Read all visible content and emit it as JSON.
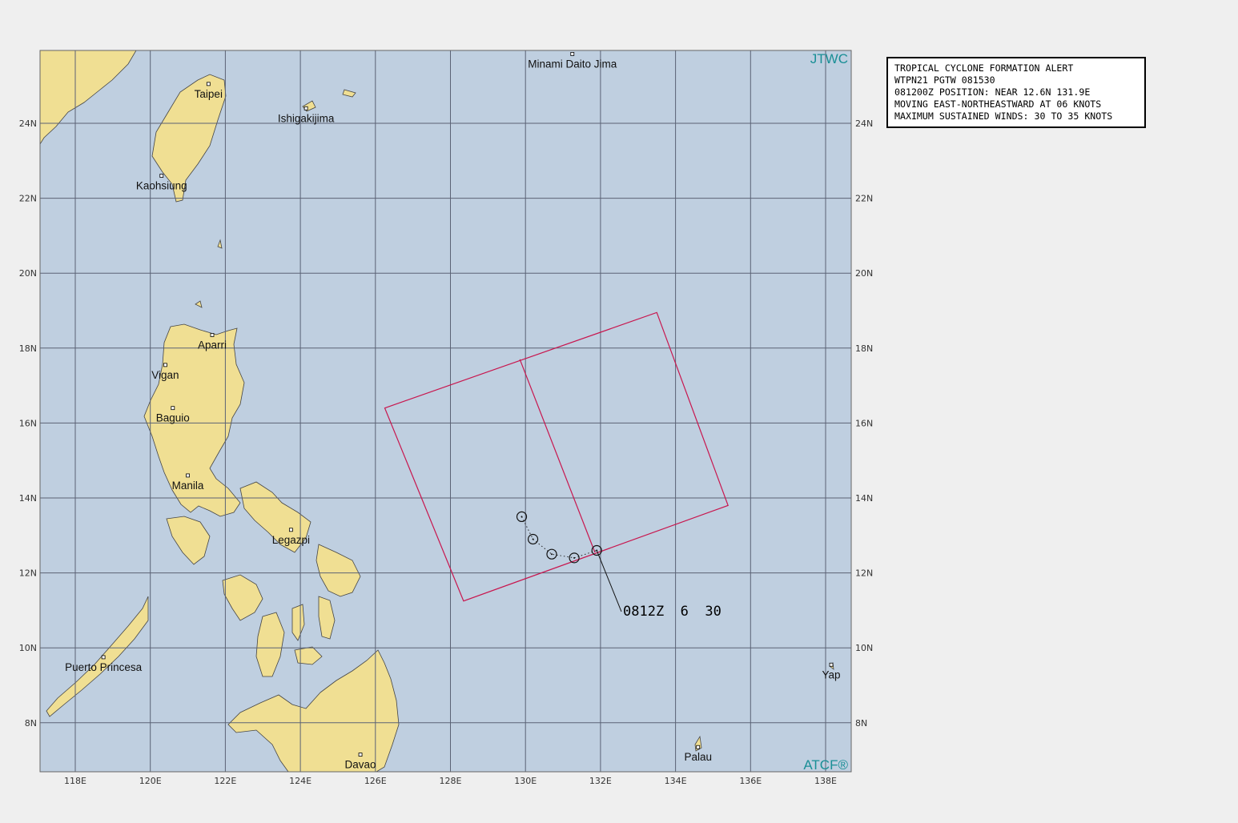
{
  "branding": {
    "top_right": "JTWC",
    "bottom_right": "ATCF®",
    "color": "#1a8f96"
  },
  "alert": {
    "title": "TROPICAL CYCLONE FORMATION ALERT",
    "line2": "WTPN21 PGTW 081530",
    "line3": "081200Z POSITION: NEAR 12.6N 131.9E",
    "line4": "MOVING EAST-NORTHEASTWARD AT 06 KNOTS",
    "line5": "MAXIMUM SUSTAINED WINDS: 30 TO 35 KNOTS"
  },
  "axes": {
    "lon_labels": [
      "118E",
      "120E",
      "122E",
      "124E",
      "126E",
      "128E",
      "130E",
      "132E",
      "134E",
      "136E",
      "138E"
    ],
    "lat_labels": [
      "24N",
      "22N",
      "20N",
      "18N",
      "16N",
      "14N",
      "12N",
      "10N",
      "8N"
    ]
  },
  "places": [
    {
      "name": "Minami Daito Jima",
      "lat": 25.85,
      "lon": 131.25
    },
    {
      "name": "Taipei",
      "lat": 25.05,
      "lon": 121.55
    },
    {
      "name": "Ishigakijima",
      "lat": 24.4,
      "lon": 124.15
    },
    {
      "name": "Kaohsiung",
      "lat": 22.6,
      "lon": 120.3
    },
    {
      "name": "Aparri",
      "lat": 18.35,
      "lon": 121.65
    },
    {
      "name": "Vigan",
      "lat": 17.55,
      "lon": 120.4
    },
    {
      "name": "Baguio",
      "lat": 16.4,
      "lon": 120.6
    },
    {
      "name": "Manila",
      "lat": 14.6,
      "lon": 121.0
    },
    {
      "name": "Legazpi",
      "lat": 13.15,
      "lon": 123.75
    },
    {
      "name": "Puerto Princesa",
      "lat": 9.75,
      "lon": 118.75
    },
    {
      "name": "Yap",
      "lat": 9.55,
      "lon": 138.15
    },
    {
      "name": "Palau",
      "lat": 7.35,
      "lon": 134.6
    },
    {
      "name": "Davao",
      "lat": 7.15,
      "lon": 125.6
    }
  ],
  "track": {
    "label": "0812Z  6  30",
    "positions": [
      {
        "lat": 13.5,
        "lon": 129.9
      },
      {
        "lat": 12.9,
        "lon": 130.2
      },
      {
        "lat": 12.5,
        "lon": 130.7
      },
      {
        "lat": 12.4,
        "lon": 131.3
      },
      {
        "lat": 12.6,
        "lon": 131.9
      }
    ]
  },
  "alert_area": {
    "outline_color": "#c8164e",
    "corners": [
      {
        "lat": 16.4,
        "lon": 126.25
      },
      {
        "lat": 18.95,
        "lon": 133.5
      },
      {
        "lat": 13.8,
        "lon": 135.4
      },
      {
        "lat": 11.25,
        "lon": 128.35
      }
    ],
    "divider": [
      {
        "lat": 17.7,
        "lon": 129.85
      },
      {
        "lat": 12.55,
        "lon": 131.85
      }
    ]
  },
  "colors": {
    "ocean": "#bfcfe0",
    "land": "#f0df93",
    "grid": "#5b6275"
  }
}
